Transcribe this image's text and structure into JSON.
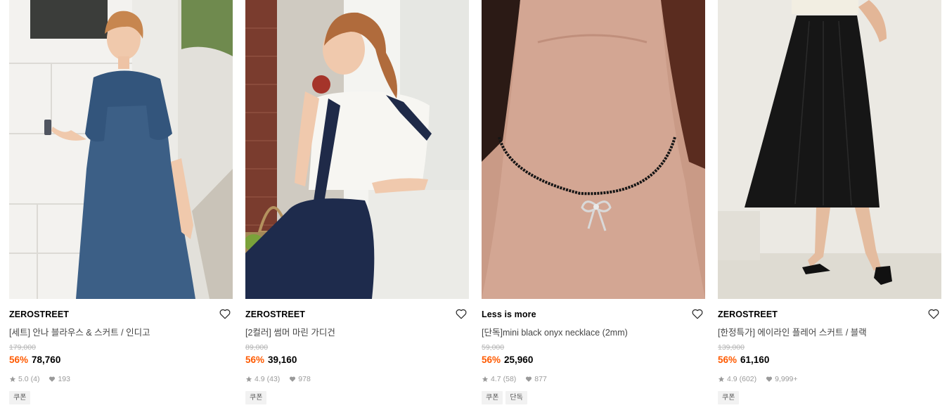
{
  "products": [
    {
      "brand": "ZEROSTREET",
      "name": "[세트] 안나 블라우스 & 스커트 / 인디고",
      "original_price": "179,000",
      "discount": "56%",
      "price": "78,760",
      "rating": "5.0",
      "reviews": "(4)",
      "likes": "193",
      "tags": [
        "쿠폰"
      ],
      "image_icon": "product-photo-denim-set"
    },
    {
      "brand": "ZEROSTREET",
      "name": "[2컬러] 썸머 마린 가디건",
      "original_price": "89,000",
      "discount": "56%",
      "price": "39,160",
      "rating": "4.9",
      "reviews": "(43)",
      "likes": "978",
      "tags": [
        "쿠폰"
      ],
      "image_icon": "product-photo-marine-cardigan"
    },
    {
      "brand": "Less is more",
      "name": "[단독]mini black onyx necklace (2mm)",
      "original_price": "59,000",
      "discount": "56%",
      "price": "25,960",
      "rating": "4.7",
      "reviews": "(58)",
      "likes": "877",
      "tags": [
        "쿠폰",
        "단독"
      ],
      "image_icon": "product-photo-necklace"
    },
    {
      "brand": "ZEROSTREET",
      "name": "[한정특가] 에이라인 플레어 스커트 / 블랙",
      "original_price": "139,000",
      "discount": "56%",
      "price": "61,160",
      "rating": "4.9",
      "reviews": "(602)",
      "likes": "9,999+",
      "tags": [
        "쿠폰"
      ],
      "image_icon": "product-photo-black-skirt"
    }
  ],
  "colors": {
    "discount": "#ff5a00",
    "original_price": "#b5b5b5",
    "meta": "#9a9a9a",
    "tag_bg": "#f2f2f2"
  }
}
